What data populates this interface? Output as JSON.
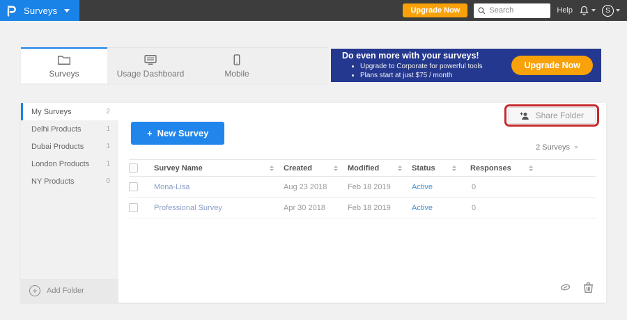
{
  "colors": {
    "accent_blue": "#1a83e8",
    "button_blue": "#2186eb",
    "orange": "#f9a109",
    "banner_navy": "#24388f",
    "annotation_red": "#c4292d",
    "status_blue": "#4a90d2",
    "link_blue": "#8b9dc7",
    "topnav_dark": "#3d3d3d"
  },
  "topnav": {
    "product_label": "Surveys",
    "upgrade_label": "Upgrade Now",
    "search_placeholder": "Search",
    "help_label": "Help",
    "avatar_initial": "S"
  },
  "tabs": [
    {
      "label": "Surveys",
      "icon": "folder-icon",
      "active": true
    },
    {
      "label": "Usage Dashboard",
      "icon": "dashboard-icon",
      "active": false
    },
    {
      "label": "Mobile",
      "icon": "mobile-icon",
      "active": false
    }
  ],
  "banner": {
    "title": "Do even more with your surveys!",
    "bullets": [
      "Upgrade to Corporate for powerful tools",
      "Plans start at just $75 / month"
    ],
    "cta_label": "Upgrade Now"
  },
  "sidebar": {
    "items": [
      {
        "label": "My Surveys",
        "count": "2",
        "active": true
      },
      {
        "label": "Delhi Products",
        "count": "1",
        "active": false
      },
      {
        "label": "Dubai Products",
        "count": "1",
        "active": false
      },
      {
        "label": "London Products",
        "count": "1",
        "active": false
      },
      {
        "label": "NY Products",
        "count": "0",
        "active": false
      }
    ],
    "add_folder_label": "Add Folder",
    "plus_glyph": "+"
  },
  "main": {
    "new_survey_plus": "+",
    "new_survey_label": "New Survey",
    "share_folder_label": "Share Folder",
    "count_dropdown_label": "2 Surveys",
    "table": {
      "columns": {
        "name": "Survey Name",
        "created": "Created",
        "modified": "Modified",
        "status": "Status",
        "responses": "Responses"
      },
      "rows": [
        {
          "name": "Mona-Lisa",
          "created": "Aug 23 2018",
          "modified": "Feb 18 2019",
          "status": "Active",
          "responses": "0"
        },
        {
          "name": "Professional Survey",
          "created": "Apr 30 2018",
          "modified": "Feb 18 2019",
          "status": "Active",
          "responses": "0"
        }
      ]
    }
  }
}
